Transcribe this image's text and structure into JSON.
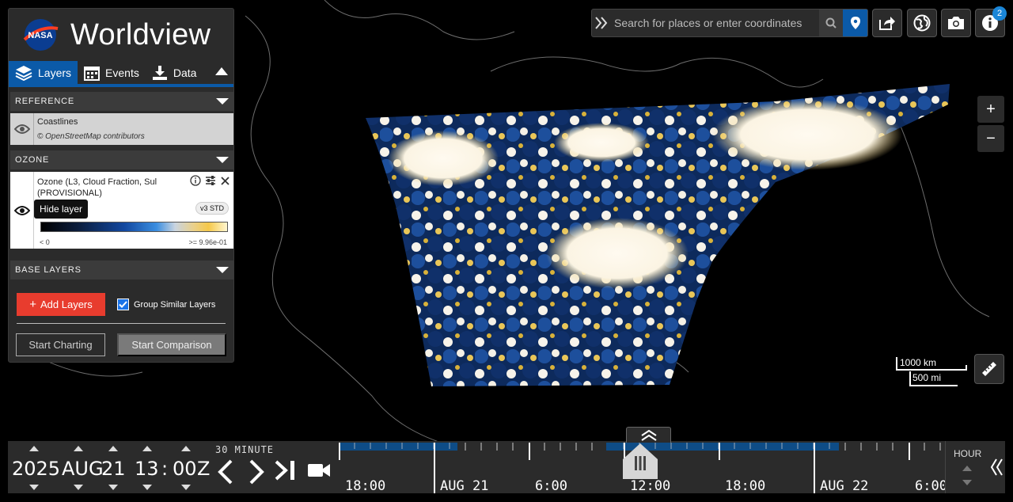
{
  "app": {
    "title": "Worldview",
    "logo_text": "NASA"
  },
  "tabs": [
    {
      "label": "Layers",
      "icon": "layers-icon",
      "active": true
    },
    {
      "label": "Events",
      "icon": "calendar-icon",
      "active": false
    },
    {
      "label": "Data",
      "icon": "download-icon",
      "active": false
    }
  ],
  "groups": {
    "reference": {
      "label": "REFERENCE",
      "layer": {
        "name": "Coastlines",
        "attribution": "© OpenStreetMap contributors"
      }
    },
    "ozone": {
      "label": "OZONE",
      "layer": {
        "name": "Ozone (L3, Cloud Fraction, Sul",
        "subtitle": "(PROVISIONAL)",
        "version": "v3 STD",
        "legend_min": "< 0",
        "legend_max": ">= 9.96e-01"
      }
    },
    "base": {
      "label": "BASE LAYERS"
    }
  },
  "tooltip": "Hide layer",
  "actions": {
    "add_layers": "Add Layers",
    "add_layers_glyph": "+",
    "group_similar": "Group Similar Layers",
    "group_similar_checked": true,
    "start_charting": "Start Charting",
    "start_comparison": "Start Comparison"
  },
  "search": {
    "placeholder": "Search for places or enter coordinates"
  },
  "toolbar": {
    "info_badge": "2"
  },
  "zoom": {
    "in": "+",
    "out": "−"
  },
  "scale": {
    "km": "1000 km",
    "mi": "500 mi"
  },
  "date": {
    "year": "2025",
    "month": "AUG",
    "day": "21",
    "hour": "13",
    "sep": ":",
    "minute": "00",
    "zone": "Z",
    "interval": "30 MINUTE"
  },
  "timeline": {
    "labels": [
      "18:00",
      "AUG 21",
      "6:00",
      "12:00",
      "18:00",
      "AUG 22",
      "6:00"
    ],
    "zoom_level": "HOUR"
  },
  "colors": {
    "panel": "#2b2b2b",
    "accent": "#0b5aa8",
    "add_layers": "#e83c2e",
    "badge": "#1a86d8"
  }
}
